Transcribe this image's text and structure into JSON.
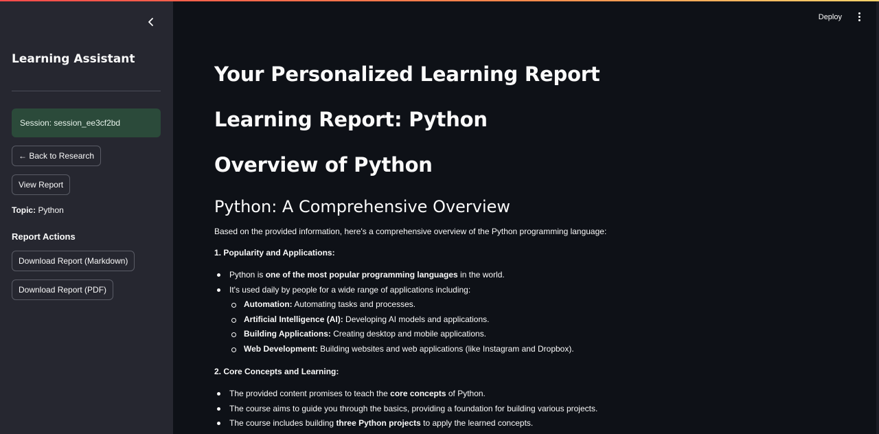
{
  "sidebar": {
    "title": "Learning Assistant",
    "session": "Session: session_ee3cf2bd",
    "back_button": "← Back to Research",
    "view_report_button": "View Report",
    "topic_label": "Topic:",
    "topic_value": "Python",
    "report_actions_heading": "Report Actions",
    "download_markdown_button": "Download Report (Markdown)",
    "download_pdf_button": "Download Report (PDF)"
  },
  "header": {
    "deploy": "Deploy"
  },
  "main": {
    "headings": [
      "Your Personalized Learning Report",
      "Learning Report: Python",
      "Overview of Python"
    ],
    "subheading": "Python: A Comprehensive Overview",
    "intro": "Based on the provided information, here's a comprehensive overview of the Python programming language:",
    "section1": {
      "title": "1. Popularity and Applications:",
      "b1_pre": "Python is ",
      "b1_bold": "one of the most popular programming languages",
      "b1_post": " in the world.",
      "b2": "It's used daily by people for a wide range of applications including:",
      "sub": [
        {
          "bold": "Automation:",
          "text": " Automating tasks and processes."
        },
        {
          "bold": "Artificial Intelligence (AI):",
          "text": " Developing AI models and applications."
        },
        {
          "bold": "Building Applications:",
          "text": " Creating desktop and mobile applications."
        },
        {
          "bold": "Web Development:",
          "text": " Building websites and web applications (like Instagram and Dropbox)."
        }
      ]
    },
    "section2": {
      "title": "2. Core Concepts and Learning:",
      "b1_pre": "The provided content promises to teach the ",
      "b1_bold": "core concepts",
      "b1_post": " of Python.",
      "b2": "The course aims to guide you through the basics, providing a foundation for building various projects.",
      "b3_pre": "The course includes building ",
      "b3_bold": "three Python projects",
      "b3_post": " to apply the learned concepts."
    }
  },
  "colors": {
    "sidebar_bg": "#262730",
    "main_bg": "#0e1117",
    "session_bg": "#2b4a3a",
    "accent": "#ff4b4b"
  }
}
